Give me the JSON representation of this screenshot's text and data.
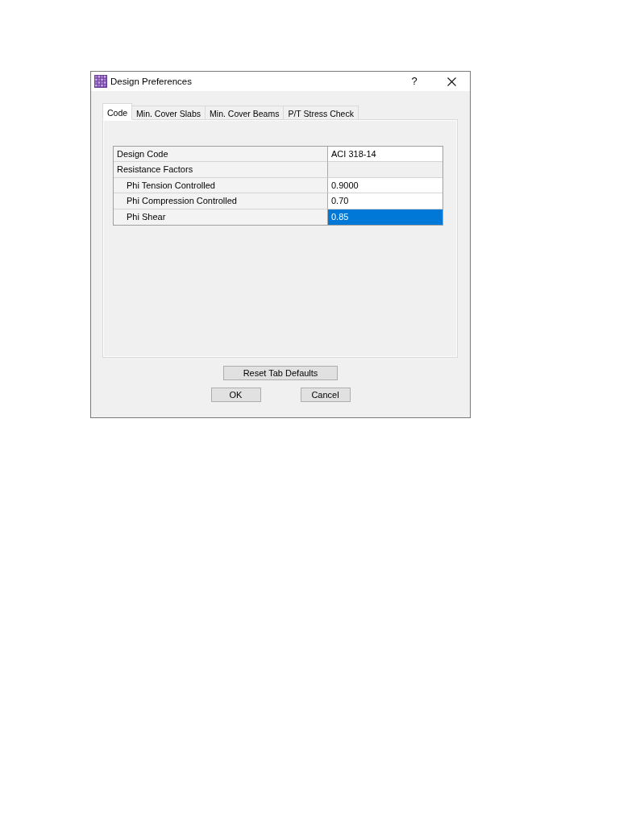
{
  "window": {
    "title": "Design Preferences",
    "help": "?"
  },
  "tabs": [
    {
      "label": "Code",
      "selected": true
    },
    {
      "label": "Min. Cover Slabs",
      "selected": false
    },
    {
      "label": "Min. Cover Beams",
      "selected": false
    },
    {
      "label": "P/T Stress Check",
      "selected": false
    }
  ],
  "grid": {
    "rows": [
      {
        "label": "Design Code",
        "value": "ACI 318-14",
        "selected": false
      },
      {
        "label": "Resistance Factors",
        "selected": false,
        "children": [
          {
            "label": "Phi Tension Controlled",
            "value": "0.9000",
            "selected": false
          },
          {
            "label": "Phi Compression Controlled",
            "value": "0.70",
            "selected": false
          },
          {
            "label": "Phi Shear",
            "value": "0.85",
            "selected": true
          }
        ]
      }
    ]
  },
  "reset_button": "Reset Tab Defaults",
  "buttons": [
    "OK",
    "Cancel"
  ]
}
